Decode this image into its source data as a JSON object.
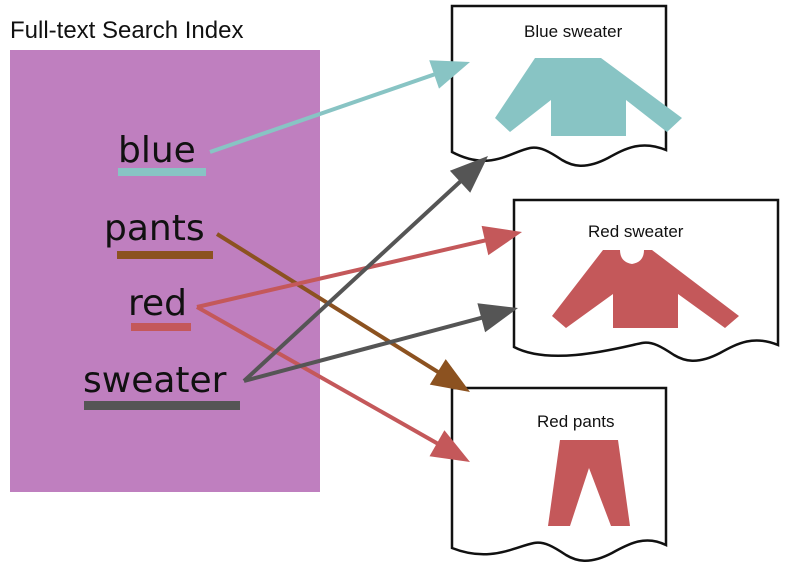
{
  "index": {
    "title": "Full-text Search Index",
    "panel_color": "#bf7fbf",
    "terms": [
      {
        "id": "blue",
        "label": "blue",
        "color": "#88c4c4"
      },
      {
        "id": "pants",
        "label": "pants",
        "color": "#8c5220"
      },
      {
        "id": "red",
        "label": "red",
        "color": "#c4585a"
      },
      {
        "id": "sweater",
        "label": "sweater",
        "color": "#555555"
      }
    ]
  },
  "documents": [
    {
      "id": "blue-sweater",
      "title": "Blue sweater",
      "item": "sweater",
      "item_color": "#88c4c4"
    },
    {
      "id": "red-sweater",
      "title": "Red sweater",
      "item": "sweater",
      "item_color": "#c4585a"
    },
    {
      "id": "red-pants",
      "title": "Red pants",
      "item": "pants",
      "item_color": "#c4585a"
    }
  ],
  "links": [
    {
      "from": "blue",
      "to": "blue-sweater"
    },
    {
      "from": "pants",
      "to": "red-pants"
    },
    {
      "from": "red",
      "to": "red-sweater"
    },
    {
      "from": "red",
      "to": "red-pants"
    },
    {
      "from": "sweater",
      "to": "blue-sweater"
    },
    {
      "from": "sweater",
      "to": "red-sweater"
    }
  ]
}
